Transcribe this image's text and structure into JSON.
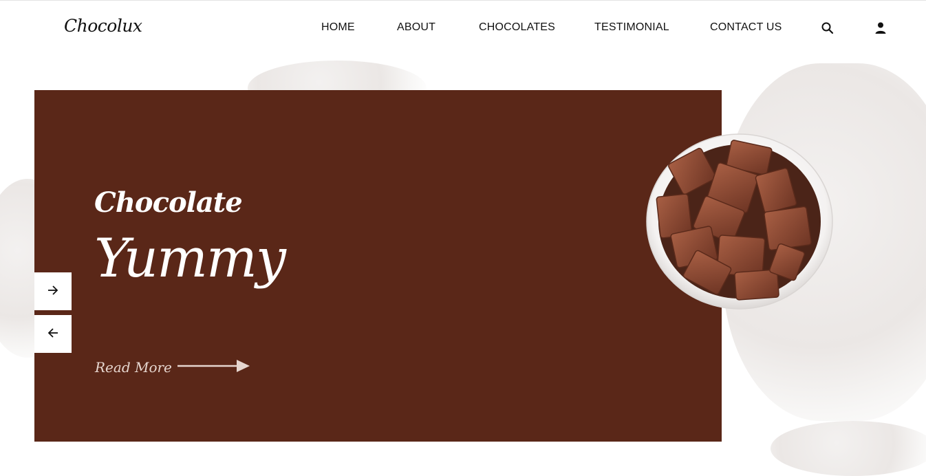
{
  "brand": {
    "logo_text": "Chocolux"
  },
  "nav": {
    "items": [
      {
        "label": "HOME"
      },
      {
        "label": "ABOUT"
      },
      {
        "label": "CHOCOLATES"
      },
      {
        "label": "TESTIMONIAL"
      },
      {
        "label": "CONTACT US"
      }
    ],
    "icons": [
      "search-icon",
      "user-icon"
    ]
  },
  "hero": {
    "title_small": "Chocolate",
    "title_large": "Yummy",
    "read_more_label": "Read More"
  },
  "slider": {
    "next_icon": "arrow-right-icon",
    "prev_icon": "arrow-left-icon"
  },
  "colors": {
    "hero_bg": "#5a2718",
    "chocolate": "#8a4a34",
    "text_dark": "#111111",
    "white": "#ffffff"
  }
}
